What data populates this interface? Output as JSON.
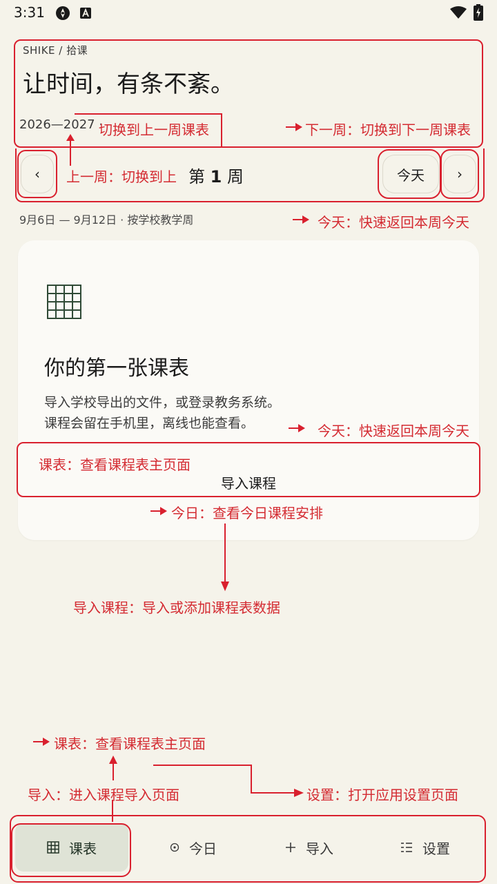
{
  "status_bar": {
    "time": "3:31"
  },
  "header": {
    "breadcrumb": "SHIKE / 拾课",
    "headline": "让时间，有条不紊。",
    "year": "2026—2027 ·"
  },
  "week_nav": {
    "prev_icon": "‹",
    "week_prefix": "第",
    "week_number": "1",
    "week_suffix": "周",
    "today_label": "今天",
    "next_icon": "›",
    "date_range": "9月6日 — 9月12日 · 按学校教学周"
  },
  "card": {
    "title": "你的第一张课表",
    "desc_line1": "导入学校导出的文件，或登录教务系统。",
    "desc_line2": "课程会留在手机里，离线也能查看。",
    "import_button": "导入课程"
  },
  "bottom_nav": {
    "items": [
      {
        "label": "课表",
        "icon": "grid-icon",
        "active": true
      },
      {
        "label": "今日",
        "icon": "dot-circle-icon",
        "active": false
      },
      {
        "label": "导入",
        "icon": "plus-icon",
        "active": false
      },
      {
        "label": "设置",
        "icon": "list-icon",
        "active": false
      }
    ]
  },
  "annotations": {
    "prev_week_switch": "切换到上一周课表",
    "next_week": "下一周：切换到下一周课表",
    "prev_week": "上一周：切换到上",
    "today_1": "今天：快速返回本周今天",
    "today_2": "今天：快速返回本周今天",
    "schedule_main": "课表：查看课程表主页面",
    "today_day": "今日：查看今日课程安排",
    "import_courses": "导入课程：导入或添加课程表数据",
    "schedule_nav": "课表：查看课程表主页面",
    "import_nav": "导入：进入课程导入页面",
    "settings_nav": "设置：打开应用设置页面"
  },
  "colors": {
    "background": "#f5f3ea",
    "annotation": "#d9202e",
    "active_tab": "#dfe3d6",
    "grid_icon": "#2f4a36"
  }
}
